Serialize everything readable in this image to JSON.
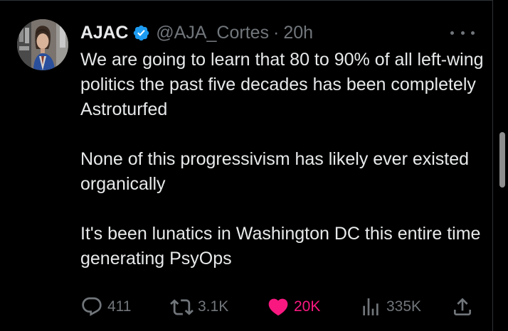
{
  "tweet": {
    "author_name": "AJAC",
    "handle": "@AJA_Cortes",
    "separator": "·",
    "time": "20h",
    "paragraphs": [
      "We are going to learn that 80 to 90% of all left-wing politics the past five decades has been completely Astroturfed",
      "None of this progressivism has likely ever existed organically",
      "It's been lunatics in Washington DC this entire time generating PsyOps"
    ]
  },
  "actions": {
    "replies": "411",
    "reposts": "3.1K",
    "likes": "20K",
    "views": "335K"
  },
  "icons": {
    "verified": "verified-badge-icon",
    "more": "more-options-icon",
    "reply": "reply-icon",
    "repost": "repost-icon",
    "like": "heart-icon",
    "views": "analytics-icon",
    "share": "share-icon"
  },
  "colors": {
    "background": "#000000",
    "text": "#e7e9ea",
    "muted": "#71767b",
    "verified": "#1d9bf0",
    "like": "#f91880"
  }
}
